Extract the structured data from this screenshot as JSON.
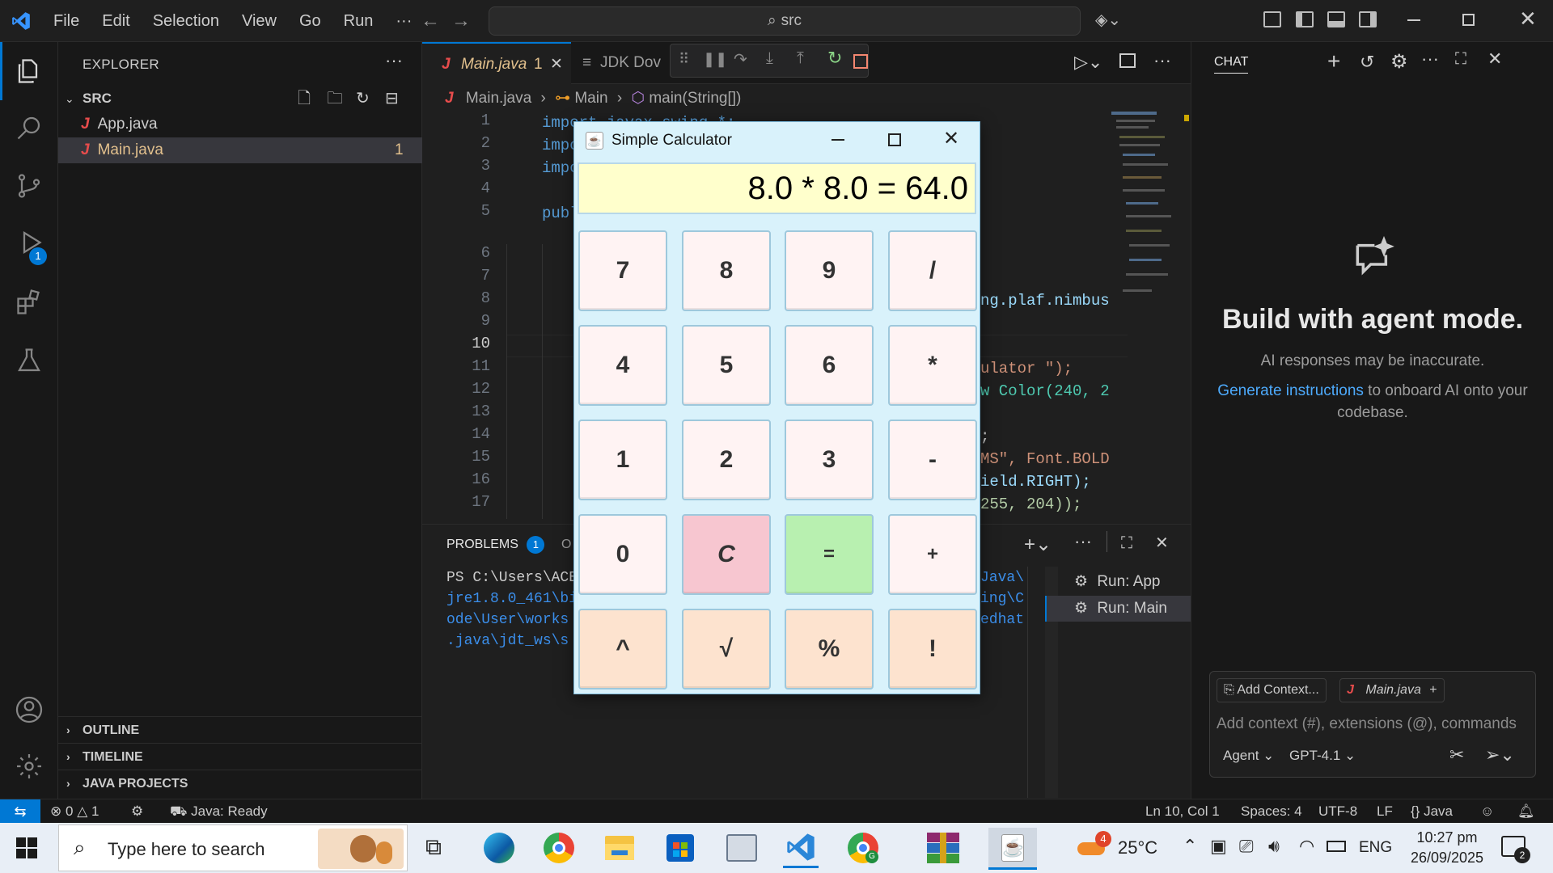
{
  "titlebar": {
    "menus": [
      "File",
      "Edit",
      "Selection",
      "View",
      "Go",
      "Run",
      "···"
    ],
    "search": "src"
  },
  "explorer": {
    "title": "EXPLORER",
    "folder": "SRC",
    "files": [
      {
        "name": "App.java",
        "badge": ""
      },
      {
        "name": "Main.java",
        "badge": "1"
      }
    ],
    "sections": [
      "OUTLINE",
      "TIMELINE",
      "JAVA PROJECTS"
    ]
  },
  "activity": {
    "debug_badge": "1"
  },
  "editor": {
    "tabs": [
      {
        "label": "Main.java",
        "badge": "1"
      },
      {
        "label": "JDK Dov"
      }
    ],
    "breadcrumb": {
      "file": "Main.java",
      "class": "Main",
      "method": "main(String[])"
    },
    "line_numbers": [
      "1",
      "2",
      "3",
      "4",
      "5",
      "6",
      "7",
      "8",
      "9",
      "10",
      "11",
      "12",
      "13",
      "14",
      "15",
      "16",
      "17"
    ],
    "left_code": [
      "import javax.swing.*;",
      "impo",
      "impo",
      "",
      "publ"
    ],
    "right_code": [
      {
        "line": 8,
        "text": "ng.plaf.nimbus"
      },
      {
        "line": 11,
        "text": "ulator \");"
      },
      {
        "line": 12,
        "text": "w Color(240, 2"
      },
      {
        "line": 14,
        "text": ";"
      },
      {
        "line": 15,
        "text": "MS\", Font.BOLD"
      },
      {
        "line": 16,
        "text": "ield.RIGHT);"
      },
      {
        "line": 17,
        "text": "255, 204));"
      }
    ]
  },
  "panel": {
    "tab_problems": "PROBLEMS",
    "problems_count": "1",
    "tab_output": "O",
    "terminal_lines": [
      "PS C:\\Users\\ACE",
      "jre1.8.0_461\\bi",
      "ode\\User\\works",
      ".java\\jdt_ws\\s"
    ],
    "terminal_right": [
      "Java\\",
      "ing\\C",
      "edhat"
    ],
    "run_sessions": [
      "Run: App",
      "Run: Main"
    ]
  },
  "chat": {
    "title": "CHAT",
    "heading": "Build with agent mode.",
    "subtitle": "AI responses may be inaccurate.",
    "link": "Generate instructions",
    "link_rest": " to onboard AI onto your codebase.",
    "add_context": "Add Context...",
    "context_file": "Main.java",
    "input_placeholder": "Add context (#), extensions (@), commands",
    "mode": "Agent",
    "model": "GPT-4.1"
  },
  "calculator": {
    "title": "Simple Calculator",
    "display": "8.0 * 8.0 = 64.0",
    "buttons": [
      [
        "7",
        "8",
        "9",
        "/"
      ],
      [
        "4",
        "5",
        "6",
        "*"
      ],
      [
        "1",
        "2",
        "3",
        "-"
      ],
      [
        "0",
        "C",
        "=",
        "+"
      ],
      [
        "^",
        "√",
        "%",
        "!"
      ]
    ]
  },
  "statusbar": {
    "errors": "0",
    "warnings": "1",
    "java_status": "Java: Ready",
    "cursor": "Ln 10, Col 1",
    "spaces": "Spaces: 4",
    "encoding": "UTF-8",
    "eol": "LF",
    "language": "Java"
  },
  "taskbar": {
    "search_placeholder": "Type here to search",
    "weather": "25°C",
    "weather_badge": "4",
    "language": "ENG",
    "time": "10:27 pm",
    "date": "26/09/2025",
    "notif_count": "2"
  },
  "colors": {
    "accent": "#0078d4",
    "java_red": "#e84c4c",
    "calc_display": "#ffffcc",
    "calc_clear": "#f7c6d0",
    "calc_equals": "#b8f0b0",
    "calc_func": "#fde3cf",
    "calc_num": "#fff3f3"
  }
}
